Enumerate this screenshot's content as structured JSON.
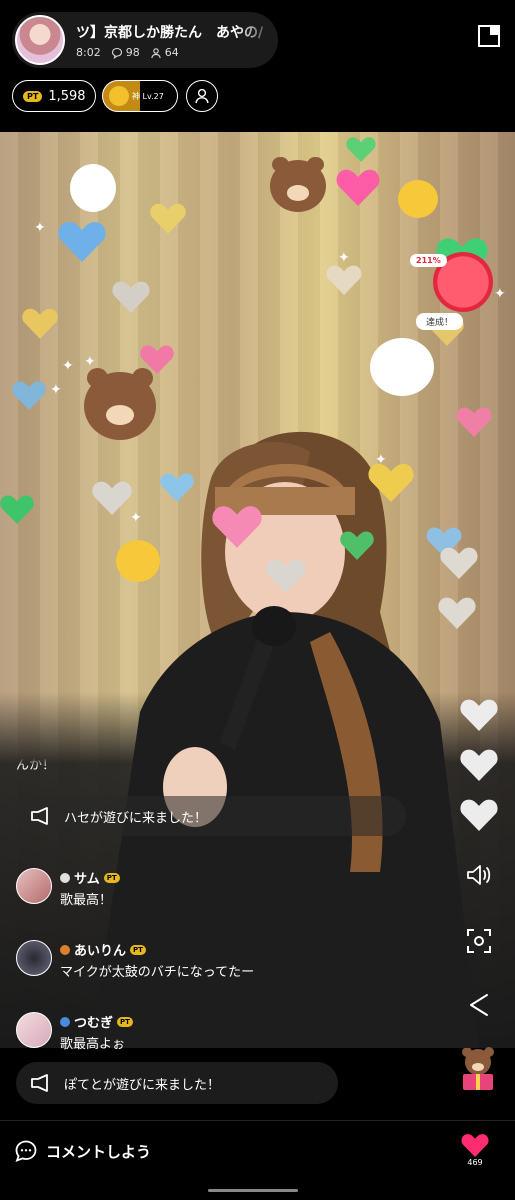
{
  "header": {
    "title": "ツ】京都しか勝たん　あやの/",
    "time": "8:02",
    "comment_count": "98",
    "viewer_count": "64",
    "points": "1,598",
    "pt_badge": "PT",
    "level_label": "神 Lv.27"
  },
  "goal": {
    "percent": "211%",
    "status": "達成！"
  },
  "comments": {
    "cut_text": "んか！",
    "system_1": "ハセが遊びに来ました！",
    "items": [
      {
        "name": "サム",
        "badge": "PT",
        "text": "歌最高！",
        "dot_color": "#e0e0e0"
      },
      {
        "name": "あいりん",
        "badge": "PT",
        "text": "マイクが太鼓のバチになってたー",
        "dot_color": "#d9822b"
      },
      {
        "name": "つむぎ",
        "badge": "PT",
        "text": "歌最高よぉ",
        "dot_color": "#4a8be0"
      }
    ]
  },
  "bottom": {
    "system_2": "ぽてとが遊びに来ました！",
    "comment_prompt": "コメントしよう",
    "like_count": "469"
  },
  "colors": {
    "accent_pink": "#ff2d6f",
    "pt_gold": "#e6b81e",
    "goal_red": "#e2273f"
  },
  "icons": [
    "close-icon",
    "comment-icon",
    "viewer-icon",
    "follow-user-icon",
    "megaphone-icon",
    "volume-icon",
    "camera-scan-icon",
    "share-icon",
    "chat-bubble-icon",
    "heart-icon",
    "gift-bear-icon"
  ]
}
